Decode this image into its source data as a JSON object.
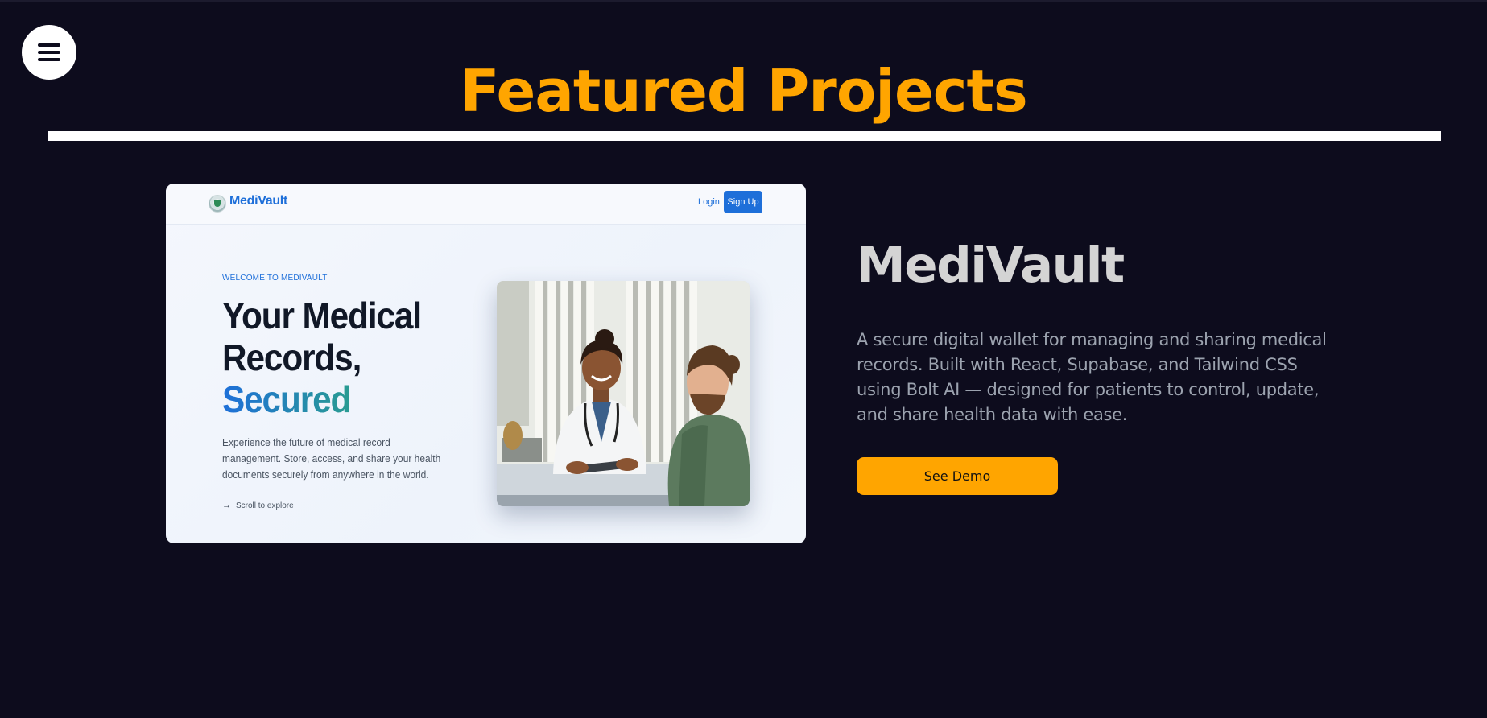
{
  "colors": {
    "background": "#0d0c1d",
    "accent": "#ffa500",
    "rule": "#ffffff",
    "preview_brand": "#1e6fd9"
  },
  "nav": {
    "menu_icon": "hamburger-menu-icon"
  },
  "section": {
    "title": "Featured Projects"
  },
  "project": {
    "name": "MediVault",
    "description": "A secure digital wallet for managing and sharing medical records. Built with React, Supabase, and Tailwind CSS using Bolt AI — designed for patients to control, update, and share health data with ease.",
    "demo_label": "See Demo",
    "preview": {
      "brand": "MediVault",
      "logo_icon": "medivault-shield-logo",
      "login_label": "Login",
      "signup_label": "Sign Up",
      "eyebrow": "WELCOME TO MEDIVAULT",
      "headline_line1": "Your Medical",
      "headline_line2": "Records,",
      "headline_accent": "Secured",
      "description": "Experience the future of medical record management. Store, access, and share your health documents securely from anywhere in the world.",
      "scroll_label": "Scroll to explore",
      "scroll_icon": "arrow-right-icon",
      "photo": "doctor-consulting-patient-photo"
    }
  }
}
